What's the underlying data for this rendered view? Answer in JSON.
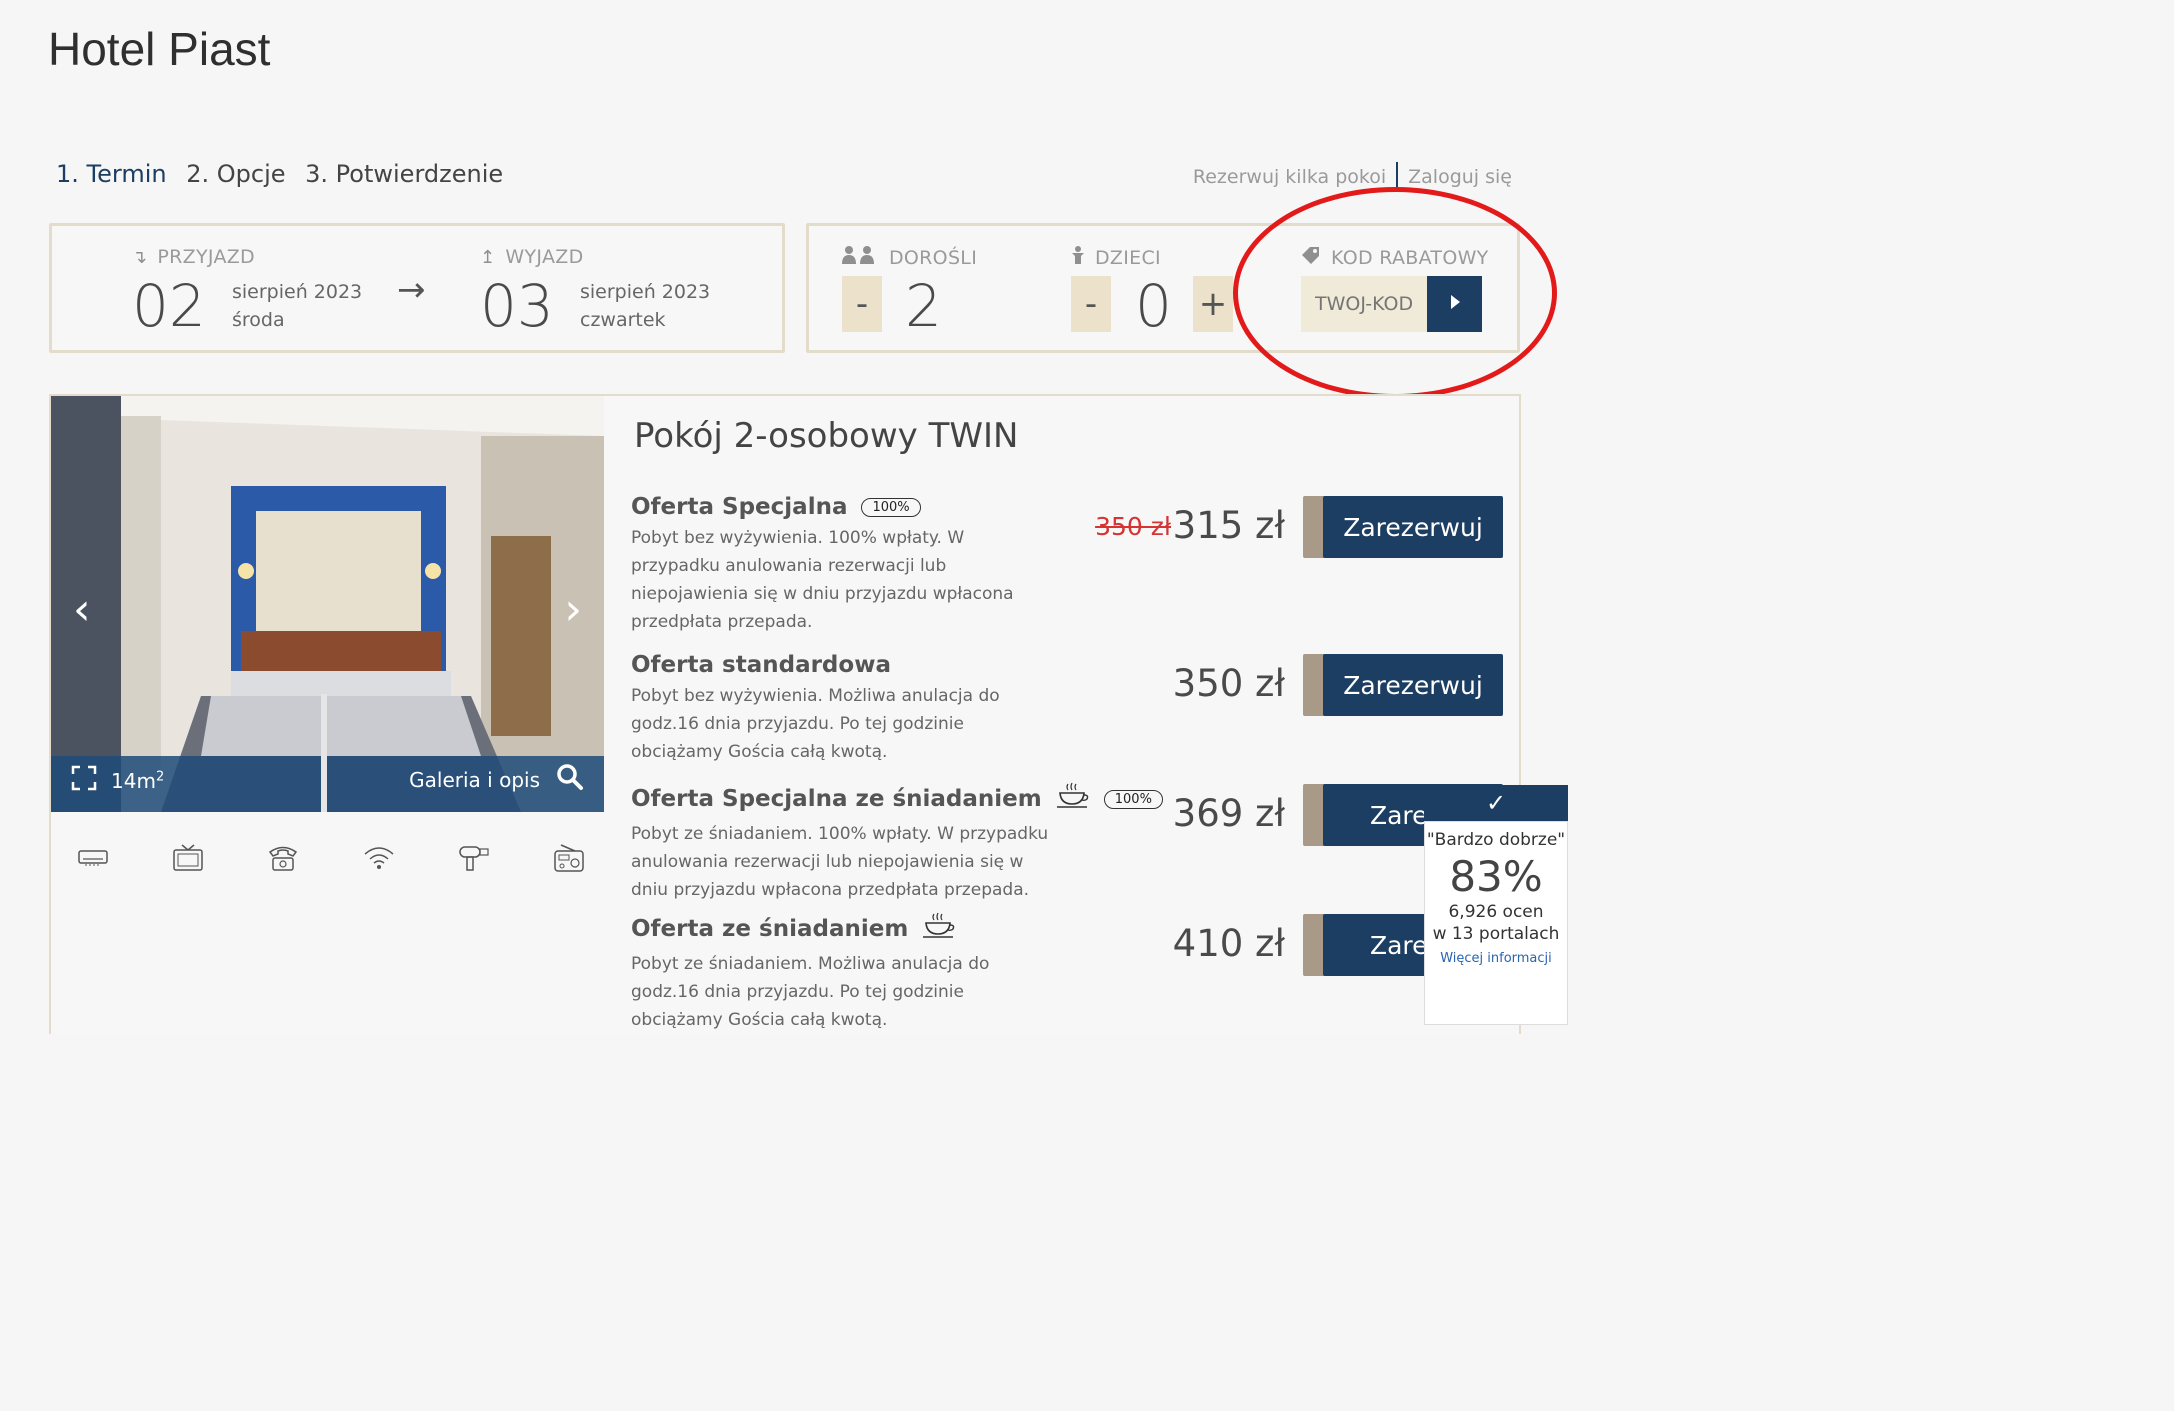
{
  "hotel": {
    "name": "Hotel Piast"
  },
  "steps": [
    "1. Termin",
    "2. Opcje",
    "3. Potwierdzenie"
  ],
  "top_links": {
    "multi_room": "Rezerwuj kilka pokoi",
    "login": "Zaloguj się"
  },
  "dates": {
    "arrival": {
      "label": "PRZYJAZD",
      "day": "02",
      "month": "sierpień 2023",
      "weekday": "środa"
    },
    "departure": {
      "label": "WYJAZD",
      "day": "03",
      "month": "sierpień 2023",
      "weekday": "czwartek"
    }
  },
  "guests": {
    "adults": {
      "label": "DOROŚLI",
      "value": "2",
      "minus": "-"
    },
    "children": {
      "label": "DZIECI",
      "value": "0",
      "minus": "-",
      "plus": "+"
    }
  },
  "discount": {
    "label": "KOD RABATOWY",
    "placeholder": "TWOJ-KOD"
  },
  "room": {
    "title": "Pokój 2-osobowy TWIN",
    "area": "14m",
    "area_sup": "2",
    "gallery_label": "Galeria i opis",
    "amenities": [
      "air-conditioner-icon",
      "tv-icon",
      "phone-icon",
      "wifi-icon",
      "hair-dryer-icon",
      "radio-icon"
    ]
  },
  "offers": [
    {
      "name": "Oferta Specjalna",
      "badge": "100%",
      "breakfast": false,
      "desc": "Pobyt bez wyżywienia. 100% wpłaty. W przypadku anulowania rezerwacji lub niepojawienia się w dniu przyjazdu wpłacona przedpłata przepada.",
      "old_price": "350 zł",
      "price": "315 zł",
      "book": "Zarezerwuj"
    },
    {
      "name": "Oferta standardowa",
      "badge": "",
      "breakfast": false,
      "desc": "Pobyt bez wyżywienia. Możliwa anulacja do godz.16 dnia przyjazdu. Po tej godzinie obciążamy Gościa całą kwotą.",
      "old_price": "",
      "price": "350 zł",
      "book": "Zarezerwuj"
    },
    {
      "name": "Oferta Specjalna ze śniadaniem",
      "badge": "100%",
      "breakfast": true,
      "desc": "Pobyt ze śniadaniem. 100% wpłaty. W przypadku anulowania rezerwacji lub niepojawienia się w dniu przyjazdu wpłacona przedpłata przepada.",
      "old_price": "",
      "price": "369 zł",
      "book": "Zareze"
    },
    {
      "name": "Oferta ze śniadaniem",
      "badge": "",
      "breakfast": true,
      "desc": "Pobyt ze śniadaniem. Możliwa anulacja do godz.16 dnia przyjazdu. Po tej godzinie obciążamy Gościa całą kwotą.",
      "old_price": "",
      "price": "410 zł",
      "book": "Zareze"
    }
  ],
  "rating": {
    "label": "\"Bardzo dobrze\"",
    "percent": "83%",
    "reviews": "6,926 ocen",
    "portals": "w 13 portalach",
    "more": "Więcej informacji",
    "check": "✓"
  },
  "colors": {
    "accent": "#1d3e63",
    "beige": "#ece2cc",
    "highlight": "#e21a1a",
    "price_old": "#d63333"
  }
}
